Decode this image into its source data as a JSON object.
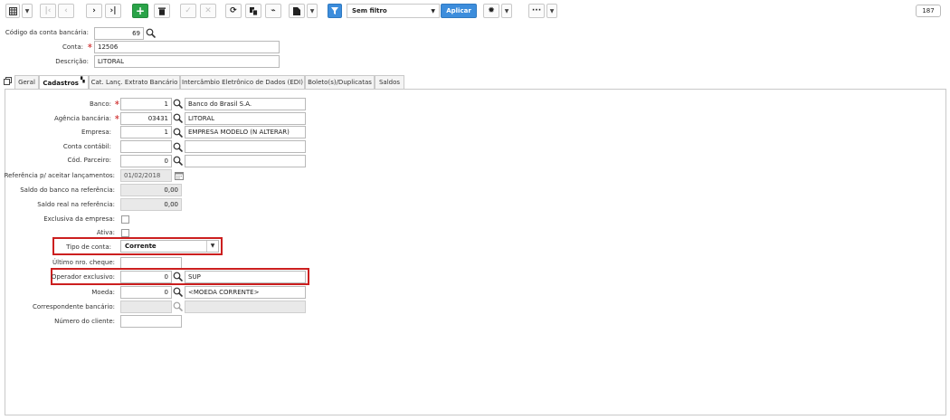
{
  "toolbar": {
    "filter_value": "Sem filtro",
    "apply_label": "Aplicar",
    "record_count": "187"
  },
  "header": {
    "bank_account_code_label": "Código da conta bancária:",
    "bank_account_code_value": "69",
    "account_label": "Conta:",
    "account_value": "12506",
    "description_label": "Descrição:",
    "description_value": "LITORAL"
  },
  "tabs": [
    {
      "label": "Geral"
    },
    {
      "label": "Cadastros"
    },
    {
      "label": "Cat. Lanç. Extrato Bancário"
    },
    {
      "label": "Intercâmbio Eletrônico de Dados (EDI)"
    },
    {
      "label": "Boleto(s)/Duplicatas"
    },
    {
      "label": "Saldos"
    }
  ],
  "form": {
    "banco_label": "Banco:",
    "banco_code": "1",
    "banco_name": "Banco do Brasil S.A.",
    "agencia_label": "Agência bancária:",
    "agencia_code": "03431",
    "agencia_name": "LITORAL",
    "empresa_label": "Empresa:",
    "empresa_code": "1",
    "empresa_name": "EMPRESA MODELO (N ALTERAR)",
    "conta_contabil_label": "Conta contábil:",
    "conta_contabil_value": "",
    "parceiro_label": "Cód. Parceiro:",
    "parceiro_code": "0",
    "parceiro_name": "",
    "referencia_label": "Referência p/ aceitar lançamentos:",
    "referencia_value": "01/02/2018",
    "saldo_banco_label": "Saldo do banco na referência:",
    "saldo_banco_value": "0,00",
    "saldo_real_label": "Saldo real na referência:",
    "saldo_real_value": "0,00",
    "exclusiva_label": "Exclusiva da empresa:",
    "ativa_label": "Ativa:",
    "tipo_conta_label": "Tipo de conta:",
    "tipo_conta_value": "Corrente",
    "ultimo_cheque_label": "Último nro. cheque:",
    "ultimo_cheque_value": "",
    "operador_label": "Operador exclusivo:",
    "operador_code": "0",
    "operador_name": "SUP",
    "moeda_label": "Moeda:",
    "moeda_code": "0",
    "moeda_name": "<MOEDA CORRENTE>",
    "correspondente_label": "Correspondente bancário:",
    "correspondente_value": "",
    "numero_cliente_label": "Número do cliente:",
    "numero_cliente_value": ""
  },
  "colors": {
    "highlight": "#cc1f1f",
    "add_button": "#2aa348",
    "apply_button": "#3c8ddc",
    "required_marker": "#d03030"
  }
}
